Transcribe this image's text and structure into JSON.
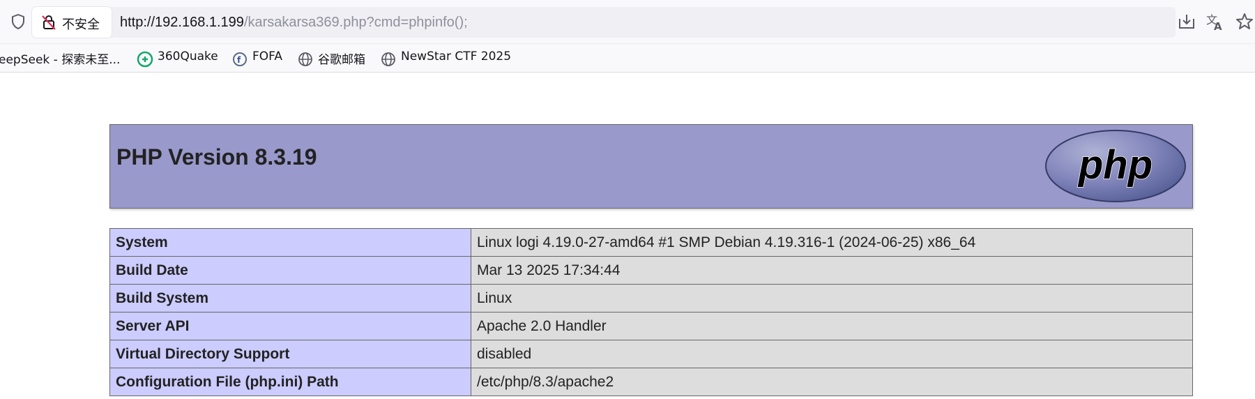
{
  "browser": {
    "security_label": "不安全",
    "url_host": "http://192.168.1.199",
    "url_rest": "/karsakarsa369.php?cmd=phpinfo();",
    "icons": [
      "shield-icon",
      "insecure-lock-icon",
      "download-icon",
      "translate-icon",
      "bookmark-star-icon"
    ]
  },
  "bookmarks": [
    {
      "label": "eepSeek - 探索未至...",
      "icon": "none"
    },
    {
      "label": "360Quake",
      "icon": "quake-icon"
    },
    {
      "label": "FOFA",
      "icon": "fofa-icon"
    },
    {
      "label": "谷歌邮箱",
      "icon": "globe-icon"
    },
    {
      "label": "NewStar CTF 2025",
      "icon": "globe-icon"
    }
  ],
  "phpinfo": {
    "title": "PHP Version 8.3.19",
    "logo_text": "php",
    "rows": [
      {
        "key": "System",
        "value": "Linux logi 4.19.0-27-amd64 #1 SMP Debian 4.19.316-1 (2024-06-25) x86_64"
      },
      {
        "key": "Build Date",
        "value": "Mar 13 2025 17:34:44"
      },
      {
        "key": "Build System",
        "value": "Linux"
      },
      {
        "key": "Server API",
        "value": "Apache 2.0 Handler"
      },
      {
        "key": "Virtual Directory Support",
        "value": "disabled"
      },
      {
        "key": "Configuration File (php.ini) Path",
        "value": "/etc/php/8.3/apache2"
      }
    ]
  },
  "colors": {
    "header_bg": "#9999cc",
    "key_cell_bg": "#ccccff",
    "value_cell_bg": "#dddddd"
  }
}
